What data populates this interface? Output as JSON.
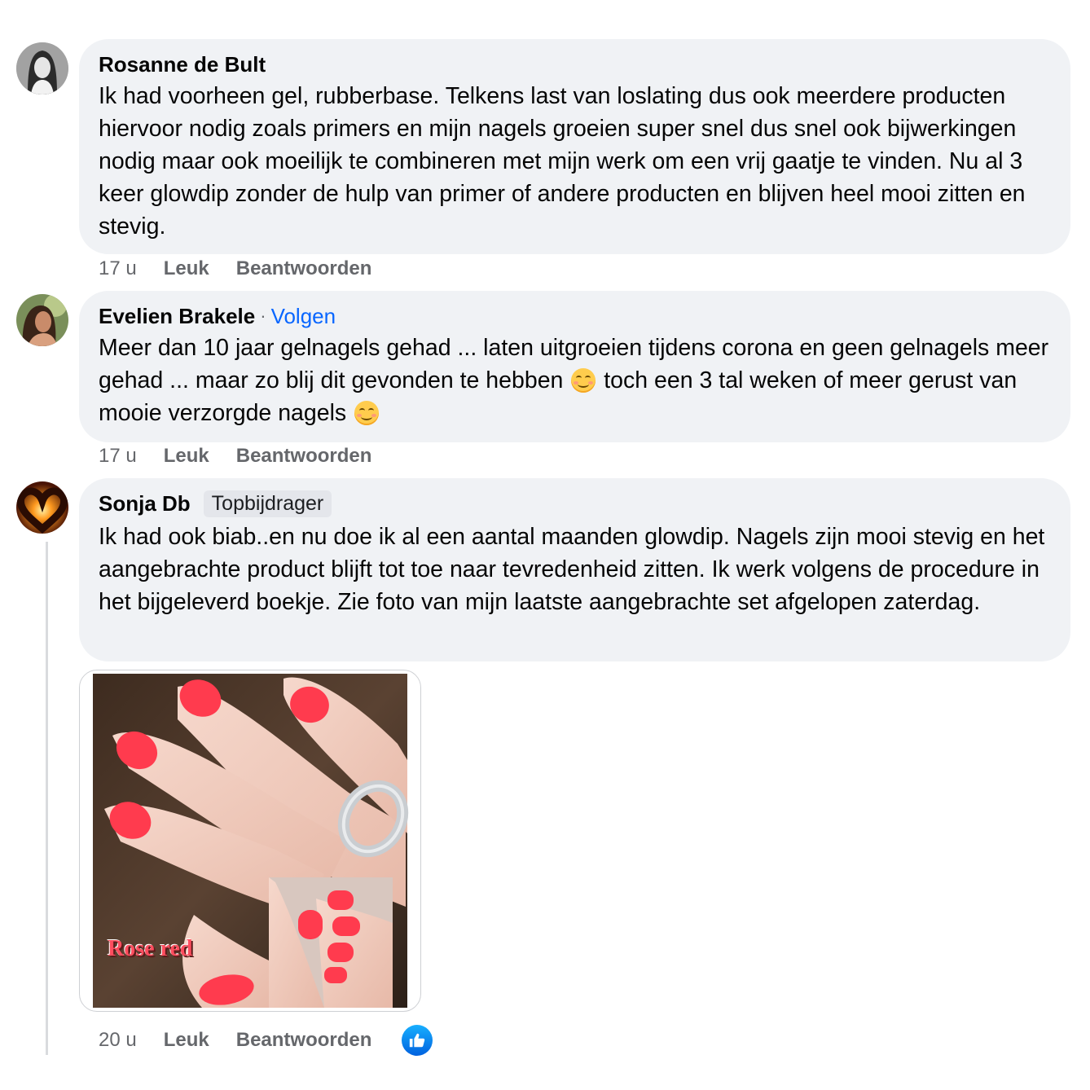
{
  "comments": [
    {
      "author": "Rosanne de Bult",
      "text": "Ik had voorheen gel, rubberbase. Telkens last van loslating dus ook meerdere producten hiervoor nodig zoals primers en mijn nagels groeien super snel dus snel ook bijwerkingen nodig maar ook moeilijk te combineren met mijn werk om een vrij gaatje te vinden. Nu al 3 keer glowdip zonder de hulp van primer of andere producten en blijven heel mooi zitten en stevig.",
      "time": "17 u",
      "like_label": "Leuk",
      "reply_label": "Beantwoorden"
    },
    {
      "author": "Evelien Brakele",
      "separator": "·",
      "follow_label": "Volgen",
      "text_parts": [
        "Meer dan 10 jaar gelnagels gehad ... laten uitgroeien tijdens corona en geen gelnagels meer gehad ... maar zo blij dit gevonden te hebben",
        "toch een 3 tal weken of meer gerust van mooie verzorgde nagels"
      ],
      "time": "17 u",
      "like_label": "Leuk",
      "reply_label": "Beantwoorden"
    },
    {
      "author": "Sonja Db",
      "badge": "Topbijdrager",
      "text": "Ik had ook biab..en nu doe ik al een aantal maanden glowdip. Nagels zijn mooi stevig en het aangebrachte product blijft tot toe naar tevredenheid zitten. Ik werk volgens de procedure in het bijgeleverd boekje. Zie foto van mijn laatste aangebrachte set afgelopen zaterdag.",
      "photo_caption": "Rose red",
      "time": "20 u",
      "like_label": "Leuk",
      "reply_label": "Beantwoorden",
      "reaction_icon": "like-icon"
    }
  ],
  "colors": {
    "bubble": "#f0f2f5",
    "link": "#0866ff",
    "muted": "#65676b",
    "nail": "#ff3b4e"
  }
}
